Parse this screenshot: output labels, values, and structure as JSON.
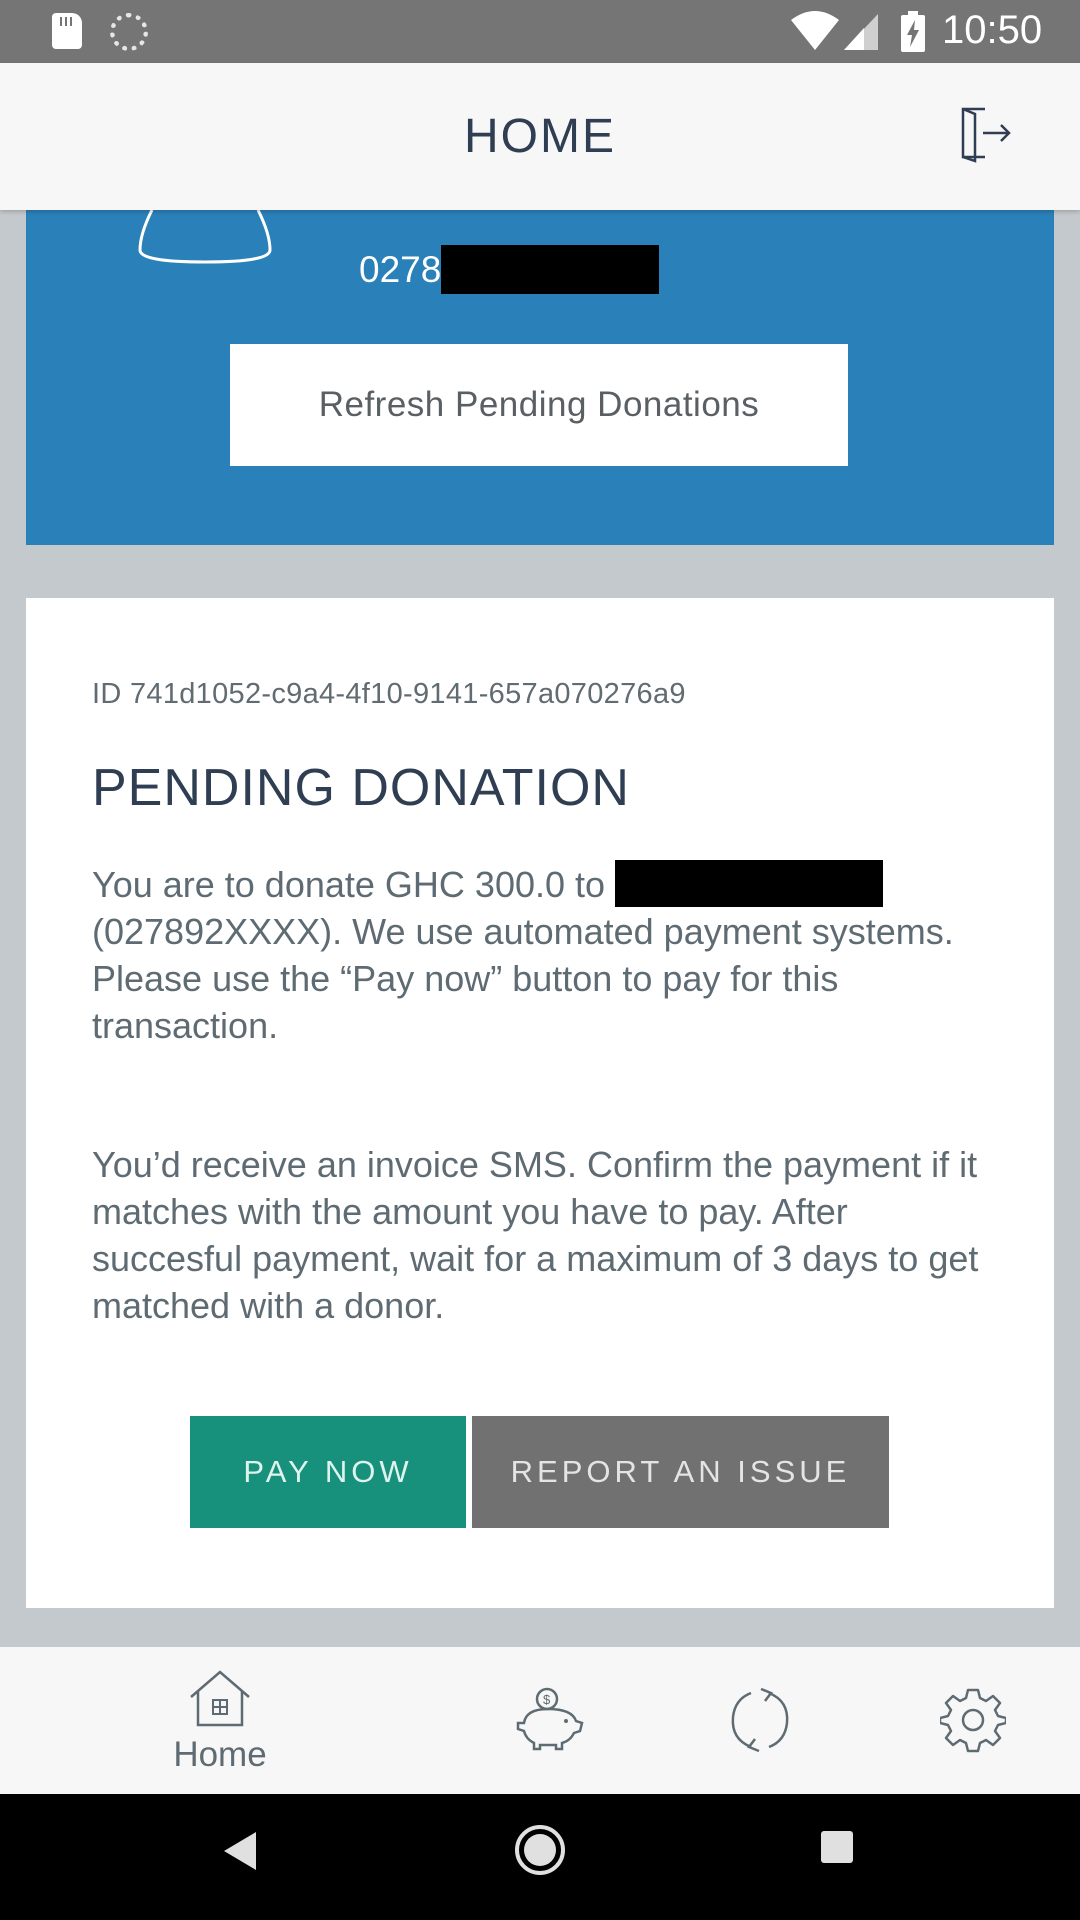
{
  "status_bar": {
    "time": "10:50"
  },
  "header": {
    "title": "HOME",
    "logout_icon": "logout-icon"
  },
  "profile": {
    "phone_prefix": "0278",
    "refresh_label": "Refresh Pending Donations"
  },
  "donation": {
    "id_text": "ID 741d1052-c9a4-4f10-9141-657a070276a9",
    "title": "PENDING DONATION",
    "text_before_recipient": "You are to donate GHC 300.0 to ",
    "text_after_recipient": "(027892XXXX). We use automated payment systems. Please use the “Pay now” button to pay for this transaction.",
    "text_invoice": " You’d receive an invoice SMS. Confirm the payment if it matches with the amount you have to pay. After succesful payment, wait for a maximum of 3 days to get matched with a donor.",
    "pay_now_label": "PAY NOW",
    "report_label": "REPORT AN ISSUE"
  },
  "bottom_nav": {
    "home_label": "Home",
    "icons": [
      "home-icon",
      "piggy-bank-icon",
      "recycle-icon",
      "settings-icon"
    ]
  },
  "colors": {
    "header_text": "#2f3e52",
    "profile_background": "#2a80b9",
    "pay_now": "#17917c",
    "report": "#717171",
    "page_background": "#c4c9cd"
  }
}
